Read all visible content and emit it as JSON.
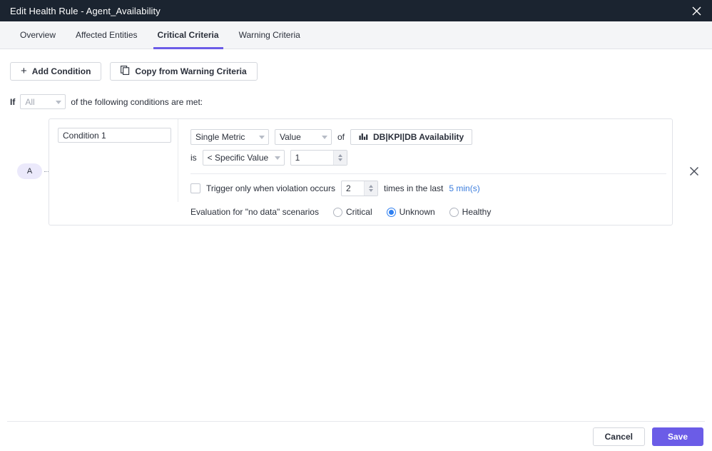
{
  "window": {
    "title": "Edit Health Rule - Agent_Availability",
    "close_icon": "close-icon"
  },
  "tabs": [
    {
      "label": "Overview",
      "active": false
    },
    {
      "label": "Affected Entities",
      "active": false
    },
    {
      "label": "Critical Criteria",
      "active": true
    },
    {
      "label": "Warning Criteria",
      "active": false
    }
  ],
  "toolbar": {
    "add_condition_label": "Add Condition",
    "add_icon": "plus-icon",
    "copy_label": "Copy from Warning Criteria",
    "copy_icon": "copy-icon"
  },
  "match": {
    "prefix": "If",
    "selector_value": "All",
    "suffix": "of the following conditions are met:"
  },
  "condition": {
    "badge": "A",
    "name_value": "Condition 1",
    "name_placeholder": "Condition Name",
    "type_value": "Single Metric",
    "aggregation_value": "Value",
    "of_label": "of",
    "metric_label": "DB|KPI|DB Availability",
    "metric_icon": "bar-chart-icon",
    "is_label": "is",
    "operator_value": "< Specific Value",
    "threshold_value": "1",
    "trigger_prefix": "Trigger only when violation occurs",
    "trigger_count": "2",
    "trigger_middle": "times in the last",
    "trigger_window": "5 min(s)",
    "trigger_checked": false,
    "nodata_label": "Evaluation for \"no data\" scenarios",
    "nodata_options": [
      {
        "label": "Critical",
        "selected": false
      },
      {
        "label": "Unknown",
        "selected": true
      },
      {
        "label": "Healthy",
        "selected": false
      }
    ],
    "remove_icon": "close-icon"
  },
  "footer": {
    "cancel_label": "Cancel",
    "save_label": "Save"
  },
  "colors": {
    "titlebar": "#1b2430",
    "accent": "#6b5ce7",
    "link": "#3b7ddd",
    "radio_selected": "#2f7ff0",
    "badge_bg": "#ebe9fb"
  }
}
